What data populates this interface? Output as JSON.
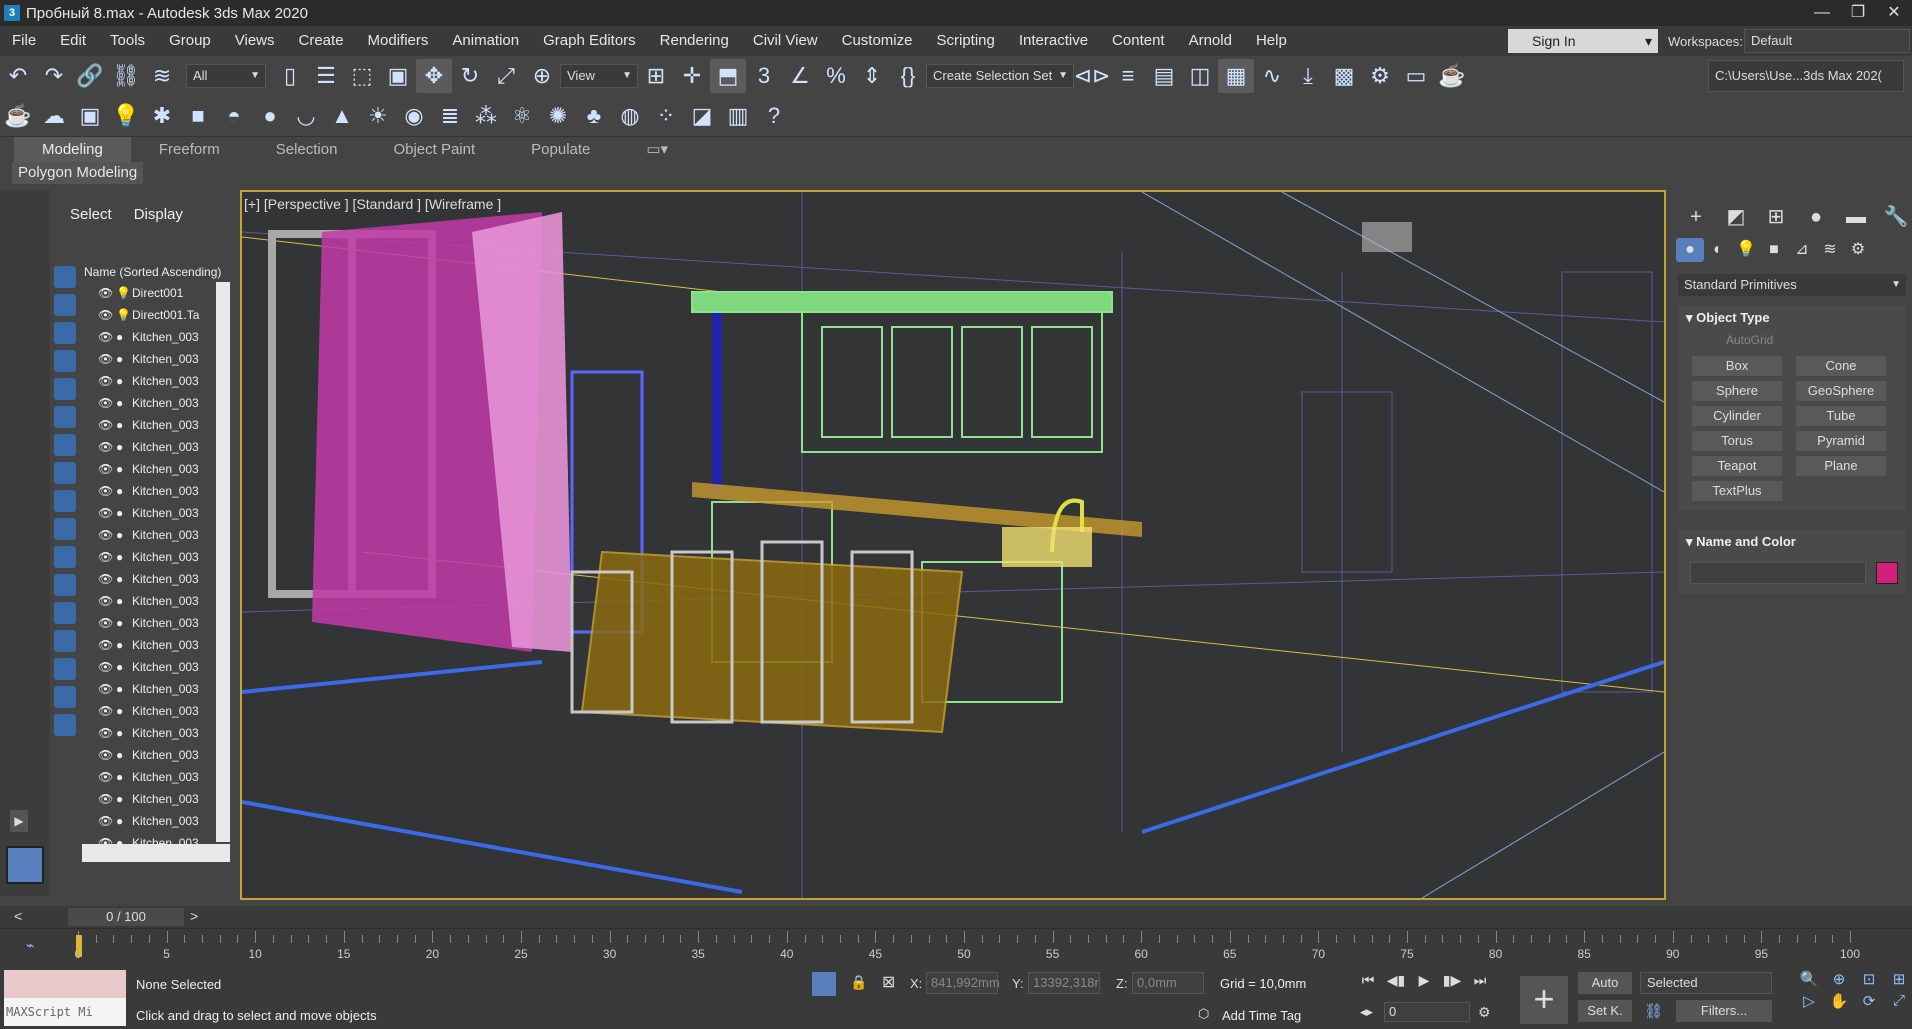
{
  "window": {
    "title": "Пробный 8.max - Autodesk 3ds Max 2020",
    "controls": [
      "—",
      "❐",
      "✕"
    ]
  },
  "menu": [
    "File",
    "Edit",
    "Tools",
    "Group",
    "Views",
    "Create",
    "Modifiers",
    "Animation",
    "Graph Editors",
    "Rendering",
    "Civil View",
    "Customize",
    "Scripting",
    "Interactive",
    "Content",
    "Arnold",
    "Help"
  ],
  "signin": {
    "label": "Sign In"
  },
  "workspaces": {
    "label": "Workspaces:",
    "value": "Default"
  },
  "toolbar": {
    "selection_filter": "All",
    "view_dropdown": "View",
    "create_selection_set": "Create Selection Set",
    "project_path": "C:\\Users\\Use...3ds Max 202("
  },
  "ribbon": {
    "tabs": [
      "Modeling",
      "Freeform",
      "Selection",
      "Object Paint",
      "Populate"
    ],
    "active_tab": "Modeling",
    "subpanel": "Polygon Modeling"
  },
  "scene_explorer": {
    "tabs": [
      "Select",
      "Display"
    ],
    "header": "Name (Sorted Ascending)",
    "rows": [
      {
        "name": "Direct001",
        "type": "light"
      },
      {
        "name": "Direct001.Ta",
        "type": "light"
      },
      {
        "name": "Kitchen_003",
        "type": "geo"
      },
      {
        "name": "Kitchen_003",
        "type": "geo"
      },
      {
        "name": "Kitchen_003",
        "type": "geo"
      },
      {
        "name": "Kitchen_003",
        "type": "geo"
      },
      {
        "name": "Kitchen_003",
        "type": "geo"
      },
      {
        "name": "Kitchen_003",
        "type": "geo"
      },
      {
        "name": "Kitchen_003",
        "type": "geo"
      },
      {
        "name": "Kitchen_003",
        "type": "geo"
      },
      {
        "name": "Kitchen_003",
        "type": "geo"
      },
      {
        "name": "Kitchen_003",
        "type": "geo"
      },
      {
        "name": "Kitchen_003",
        "type": "geo"
      },
      {
        "name": "Kitchen_003",
        "type": "geo"
      },
      {
        "name": "Kitchen_003",
        "type": "geo"
      },
      {
        "name": "Kitchen_003",
        "type": "geo"
      },
      {
        "name": "Kitchen_003",
        "type": "geo"
      },
      {
        "name": "Kitchen_003",
        "type": "geo"
      },
      {
        "name": "Kitchen_003",
        "type": "geo"
      },
      {
        "name": "Kitchen_003",
        "type": "geo"
      },
      {
        "name": "Kitchen_003",
        "type": "geo"
      },
      {
        "name": "Kitchen_003",
        "type": "geo"
      },
      {
        "name": "Kitchen_003",
        "type": "geo"
      },
      {
        "name": "Kitchen_003",
        "type": "geo"
      },
      {
        "name": "Kitchen_003",
        "type": "geo"
      },
      {
        "name": "Kitchen_003",
        "type": "geo"
      }
    ]
  },
  "viewport": {
    "label": "[+] [Perspective ] [Standard ] [Wireframe ]"
  },
  "command_panel": {
    "category": "Standard Primitives",
    "object_type_title": "Object Type",
    "autogrid": "AutoGrid",
    "primitives": [
      "Box",
      "Cone",
      "Sphere",
      "GeoSphere",
      "Cylinder",
      "Tube",
      "Torus",
      "Pyramid",
      "Teapot",
      "Plane",
      "TextPlus"
    ],
    "name_color_title": "Name and Color",
    "object_color": "#d3217b"
  },
  "time_slider": {
    "frame_display": "0 / 100",
    "left_arrow": "<",
    "right_arrow": ">"
  },
  "trackbar": {
    "ticks": [
      0,
      5,
      10,
      15,
      20,
      25,
      30,
      35,
      40,
      45,
      50,
      55,
      60,
      65,
      70,
      75,
      80,
      85,
      90,
      95,
      100
    ],
    "labels": [
      "0",
      "5",
      "10",
      "15",
      "20",
      "25",
      "30",
      "35",
      "40",
      "45",
      "50",
      "55",
      "60",
      "65",
      "70",
      "75",
      "80",
      "85",
      "90",
      "95",
      "100"
    ],
    "current_frame": 0
  },
  "status": {
    "maxscript_placeholder": "MAXScript Mi",
    "selection": "None Selected",
    "prompt": "Click and drag to select and move objects",
    "x_label": "X:",
    "x_value": "841,992mm",
    "y_label": "Y:",
    "y_value": "13392,318r",
    "z_label": "Z:",
    "z_value": "0,0mm",
    "grid": "Grid = 10,0mm",
    "add_time_tag": "Add Time Tag",
    "frame_field": "0",
    "auto_key": "Auto",
    "set_key": "Set K.",
    "selected_dropdown": "Selected",
    "filters": "Filters..."
  }
}
